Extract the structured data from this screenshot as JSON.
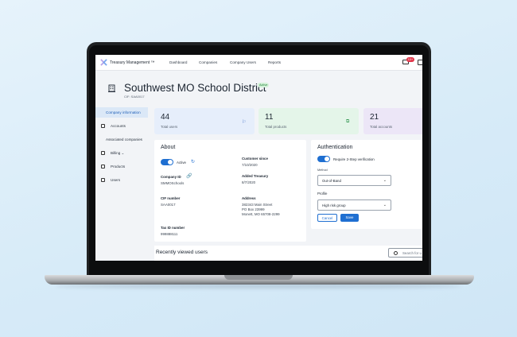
{
  "app": {
    "brand": "Treasury Management ™",
    "nav": [
      "Dashboard",
      "Companies",
      "Company Users",
      "Reports"
    ],
    "mail_badge": "10+"
  },
  "org": {
    "title": "Southwest MO School District",
    "status": "Active",
    "cif_line": "CIF: SAA0017"
  },
  "sidebar": {
    "items": [
      {
        "label": "Company information",
        "icon": "",
        "active": true
      },
      {
        "label": "Accounts",
        "icon": "account-icon"
      },
      {
        "label": "Associated companies",
        "icon": ""
      },
      {
        "label": "Billing ⌄",
        "icon": "billing-icon"
      },
      {
        "label": "Products",
        "icon": "products-icon"
      },
      {
        "label": "Users",
        "icon": "users-icon"
      }
    ]
  },
  "stats": [
    {
      "value": "44",
      "label": "Total users",
      "icon": "users-icon",
      "color": "#e6eefb"
    },
    {
      "value": "11",
      "label": "Total products",
      "icon": "products-icon",
      "color": "#e4f5e9"
    },
    {
      "value": "21",
      "label": "Total accounts",
      "icon": "accounts-icon",
      "color": "#ece6f7"
    }
  ],
  "about": {
    "title": "About",
    "active_label": "Active",
    "company_id_label": "Company ID",
    "company_id": "SMMOSchools",
    "cif_label": "CIF number",
    "cif": "SAA0017",
    "tax_label": "Tax ID number",
    "tax": "999888111",
    "customer_since_label": "Customer since",
    "customer_since": "7/10/2020",
    "added_label": "Added Treasury",
    "added": "8/7/2020",
    "address_label": "Address",
    "address": "382343 Main Street\nPO Box 23999\nMonett, MO 65708-2299"
  },
  "auth": {
    "title": "Authentication",
    "require_label": "Require 2-Step verification",
    "method_label": "Method",
    "method_value": "Out-of-Band",
    "profile_label": "Profile",
    "profile_value": "High risk group",
    "cancel": "Cancel",
    "save": "Save"
  },
  "recent": {
    "title": "Recently viewed users",
    "search_placeholder": "Search for u"
  }
}
